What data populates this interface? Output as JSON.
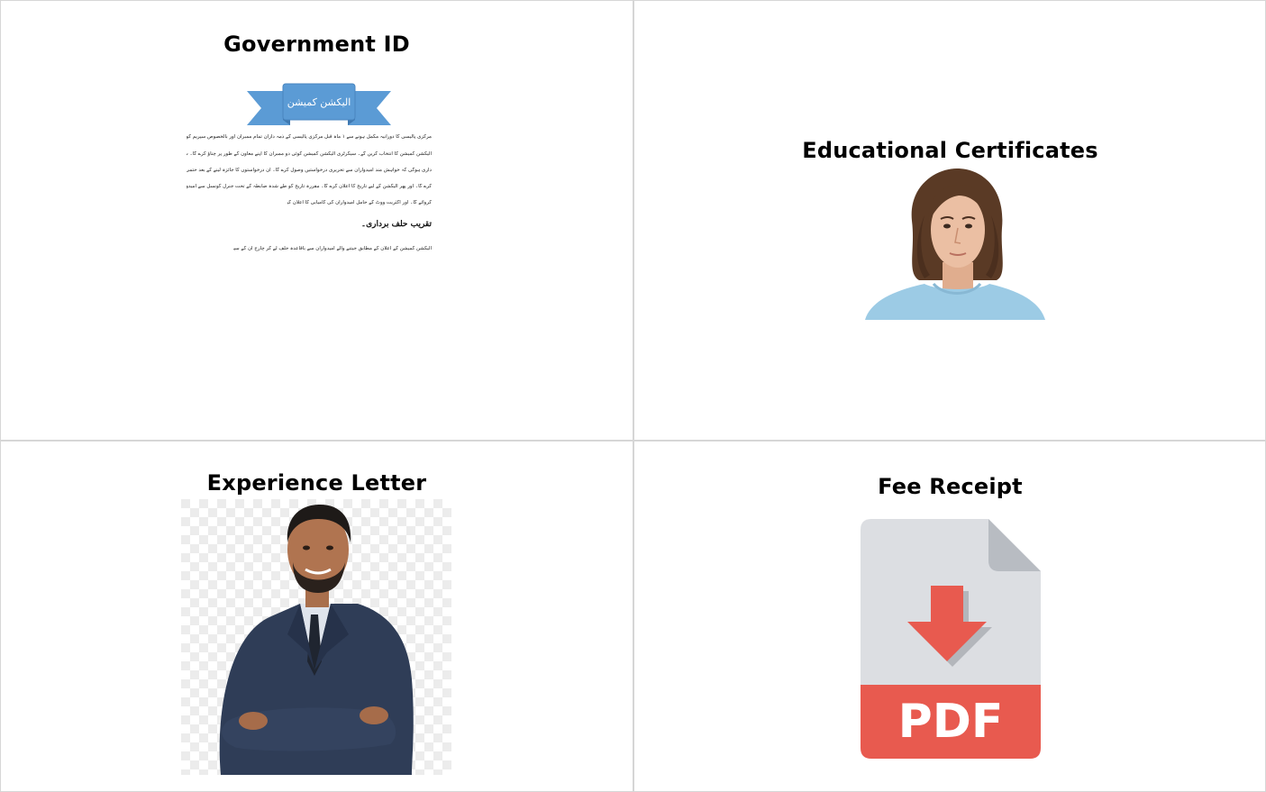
{
  "cards": [
    {
      "title": "Government ID",
      "document": {
        "banner": "الیکشن کمیشن",
        "paragraph_lines": [
          "مرکزی پالیسی کا دورانیہ مکمل ہونے سے ۱ ماہ قبل مرکزی پالیسی کے ذمہ داران تمام ممبران اور بالخصوص سپریم کونسل کی مشاورت سے سیکرٹری",
          "الیکشن کمیشن کا انتخاب کریں گے۔ سیکرٹری الیکشن کمیشن کوئی دو ممبران کا اپنے معاون کے طور پر چناؤ کرے گا۔ سیکرٹری الیکشن کمیشن کی یہ ذمہ",
          "داری ہوگی کہ خواہش مند امیدواران سے تحریری درخواستیں وصول کرے گا۔ ان درخواستوں کا جائزہ لینے کے بعد حتمی امیدواروں کا اعلان",
          "کرے گا۔ اور پھر الیکشن کے لیے تاریخ کا اعلان کرے گا۔ مقررہ تاریخ کو طے شدہ ضابطہ کے تحت جنرل کونسل سے امیدواروں کے لیے ووٹنگ",
          "کروائے گا۔ اور اکثریت ووٹ کے حامل امیدواران کی کامیابی کا اعلان کرے گا۔"
        ],
        "heading": "تقریب حلف برداری۔",
        "closing_line": "الیکشن کمیشن کے اعلان کے مطابق جیتنے والے امیدواران سے باقاعدہ حلف لے کر چارج ان کے سپرد کیا جائے گا۔"
      }
    },
    {
      "title": "Educational Certificates",
      "image": "portrait-photo-young-person"
    },
    {
      "title": "Experience Letter",
      "image": "portrait-photo-man-in-suit"
    },
    {
      "title": "Fee Receipt",
      "image": "pdf-file-icon",
      "icon_label": "PDF"
    }
  ],
  "colors": {
    "banner": "#5b9bd5",
    "pdf_red": "#e85a4f",
    "pdf_page": "#dcdee2",
    "pdf_fold": "#b8bcc2"
  }
}
